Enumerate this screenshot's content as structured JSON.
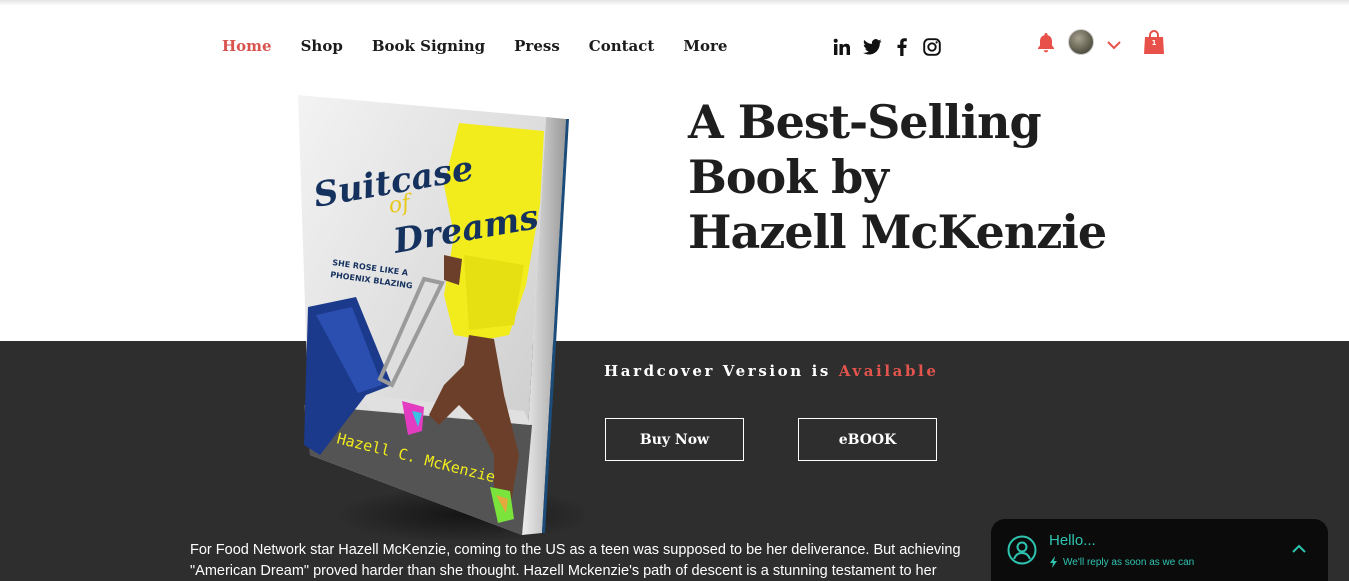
{
  "nav": {
    "items": [
      {
        "label": "Home",
        "active": true
      },
      {
        "label": "Shop"
      },
      {
        "label": "Book Signing"
      },
      {
        "label": "Press"
      },
      {
        "label": "Contact"
      },
      {
        "label": "More"
      }
    ]
  },
  "social": [
    "linkedin-icon",
    "twitter-icon",
    "facebook-icon",
    "instagram-icon"
  ],
  "header_right": {
    "cart_count": "1",
    "accent_color": "#e8504a"
  },
  "hero": {
    "headline_line1": "A Best-Selling",
    "headline_line2": "Book by",
    "headline_line3": "Hazell McKenzie"
  },
  "book_cover": {
    "title_line1": "Suitcase",
    "title_line2": "of",
    "title_line3": "Dreams",
    "tagline_line1": "SHE ROSE LIKE A",
    "tagline_line2": "PHOENIX BLAZING",
    "author": "Hazell C. McKenzie"
  },
  "availability": {
    "prefix": "Hardcover Version is",
    "highlight": "Available"
  },
  "buttons": {
    "buy_now": "Buy Now",
    "ebook": "eBOOK"
  },
  "description": {
    "line1": "For Food Network star Hazell McKenzie, coming to the US as a teen was supposed to be her deliverance. But achieving",
    "line2": "\"American Dream\" proved harder than she thought. Hazell Mckenzie's path of descent is a stunning testament to her"
  },
  "chat": {
    "title": "Hello...",
    "subtitle": "We'll reply as soon as we can"
  },
  "colors": {
    "accent": "#d9534f",
    "dark_band": "#2e2e2e",
    "chat_teal": "#2ec4b0"
  }
}
